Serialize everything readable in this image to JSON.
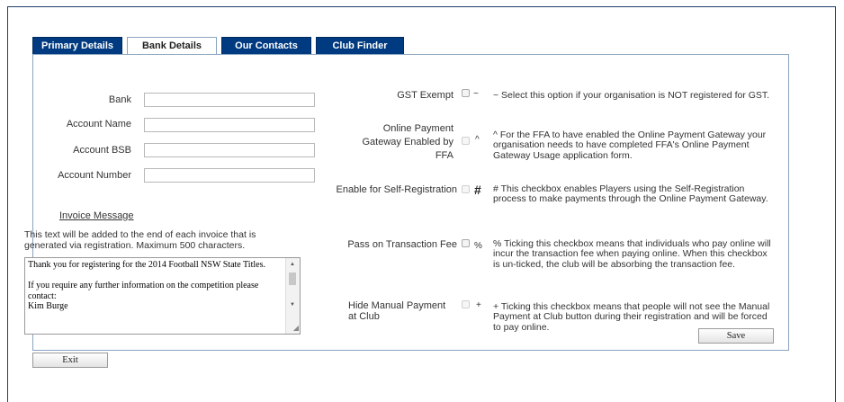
{
  "tabs": [
    {
      "label": "Primary Details",
      "active": false
    },
    {
      "label": "Bank Details",
      "active": true
    },
    {
      "label": "Our Contacts",
      "active": false
    },
    {
      "label": "Club Finder",
      "active": false
    }
  ],
  "bank_fields": {
    "bank_label": "Bank",
    "bank_value": "",
    "account_name_label": "Account Name",
    "account_name_value": "",
    "account_bsb_label": "Account BSB",
    "account_bsb_value": "",
    "account_number_label": "Account Number",
    "account_number_value": ""
  },
  "invoice": {
    "link": "Invoice Message",
    "help": "This text will be added to the end of each invoice that is generated via registration. Maximum 500 characters.",
    "message": "Thank you for registering for the 2014 Football NSW State Titles.\n\nIf you require any further information on the competition please contact:\nKim Burge"
  },
  "options": [
    {
      "label": "GST Exempt",
      "symbol": "~",
      "checked": false,
      "disabled": false,
      "description": "~ Select this option if your organisation is NOT registered for GST."
    },
    {
      "label": "Online Payment Gateway Enabled by FFA",
      "symbol": "^",
      "checked": false,
      "disabled": true,
      "description": "^ For the FFA to have enabled the Online Payment Gateway your organisation needs to have completed FFA's Online Payment Gateway Usage application form."
    },
    {
      "label": "Enable for Self-Registration",
      "symbol": "#",
      "checked": false,
      "disabled": true,
      "description": "# This checkbox enables Players using the Self-Registration process to make payments through the Online Payment Gateway."
    },
    {
      "label": "Pass on Transaction Fee",
      "symbol": "%",
      "checked": false,
      "disabled": false,
      "description": "% Ticking this checkbox means that individuals who pay online will incur the transaction fee when paying online. When this checkbox is un-ticked, the club will be absorbing the transaction fee."
    },
    {
      "label": "Hide Manual Payment at Club",
      "symbol": "+",
      "checked": false,
      "disabled": true,
      "description": "+ Ticking this checkbox means that people will not see the Manual Payment at Club button during their registration and will be forced to pay online."
    }
  ],
  "buttons": {
    "save": "Save",
    "exit": "Exit"
  },
  "icons": {
    "scroll_up": "scroll-up-arrow-icon",
    "scroll_down": "scroll-down-arrow-icon",
    "resize": "resize-grip-icon"
  }
}
